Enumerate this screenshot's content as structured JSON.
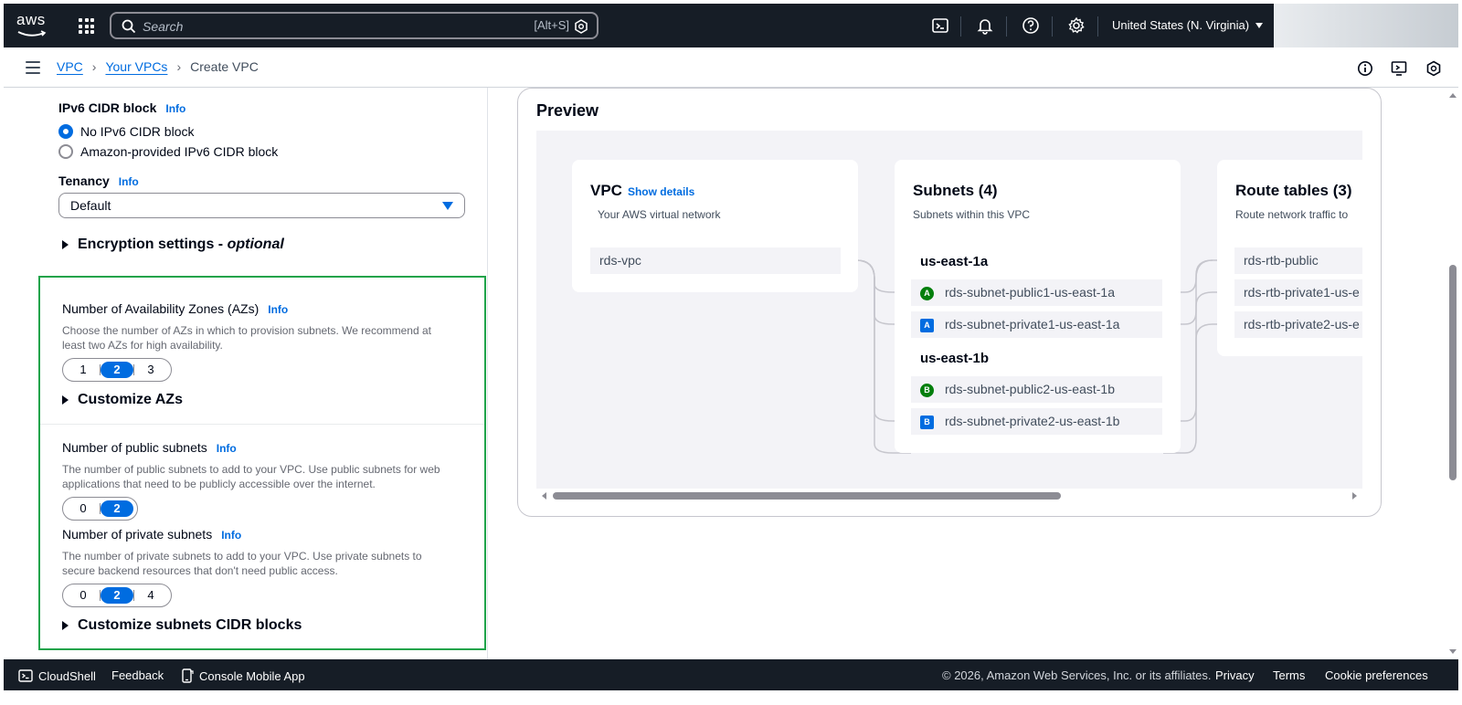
{
  "topnav": {
    "logo_text": "aws",
    "search_placeholder": "Search",
    "search_shortcut": "[Alt+S]",
    "region": "United States (N. Virginia)",
    "icons": [
      "cloudshell-icon",
      "bell-icon",
      "help-icon",
      "gear-icon"
    ]
  },
  "breadcrumb": {
    "items": [
      "VPC",
      "Your VPCs"
    ],
    "current": "Create VPC"
  },
  "form": {
    "ipv6": {
      "label": "IPv6 CIDR block",
      "info": "Info",
      "options": [
        "No IPv6 CIDR block",
        "Amazon-provided IPv6 CIDR block"
      ],
      "selected": "No IPv6 CIDR block"
    },
    "tenancy": {
      "label": "Tenancy",
      "info": "Info",
      "value": "Default"
    },
    "encryption": {
      "label": "Encryption settings - ",
      "optional": "optional"
    },
    "azs": {
      "label": "Number of Availability Zones (AZs)",
      "info": "Info",
      "description": "Choose the number of AZs in which to provision subnets. We recommend at least two AZs for high availability.",
      "options": [
        "1",
        "2",
        "3"
      ],
      "selected": "2",
      "customize": "Customize AZs"
    },
    "public_subnets": {
      "label": "Number of public subnets",
      "info": "Info",
      "description": "The number of public subnets to add to your VPC. Use public subnets for web applications that need to be publicly accessible over the internet.",
      "options": [
        "0",
        "2"
      ],
      "selected": "2"
    },
    "private_subnets": {
      "label": "Number of private subnets",
      "info": "Info",
      "description": "The number of private subnets to add to your VPC. Use private subnets to secure backend resources that don't need public access.",
      "options": [
        "0",
        "2",
        "4"
      ],
      "selected": "2",
      "customize": "Customize subnets CIDR blocks"
    }
  },
  "preview": {
    "title": "Preview",
    "vpc": {
      "title": "VPC",
      "show_details": "Show details",
      "subtitle": "Your AWS virtual network",
      "name": "rds-vpc"
    },
    "subnets": {
      "title": "Subnets (4)",
      "subtitle": "Subnets within this VPC",
      "az1": "us-east-1a",
      "az2": "us-east-1b",
      "items": [
        {
          "badge": "A",
          "name": "rds-subnet-public1-us-east-1a"
        },
        {
          "badge": "A",
          "name": "rds-subnet-private1-us-east-1a"
        },
        {
          "badge": "B",
          "name": "rds-subnet-public2-us-east-1b"
        },
        {
          "badge": "B",
          "name": "rds-subnet-private2-us-east-1b"
        }
      ]
    },
    "route_tables": {
      "title": "Route tables (3)",
      "subtitle": "Route network traffic to",
      "items": [
        "rds-rtb-public",
        "rds-rtb-private1-us-e",
        "rds-rtb-private2-us-e"
      ]
    }
  },
  "footer": {
    "cloudshell": "CloudShell",
    "feedback": "Feedback",
    "mobile_app": "Console Mobile App",
    "copyright": "© 2026, Amazon Web Services, Inc. or its affiliates.",
    "privacy": "Privacy",
    "terms": "Terms",
    "cookies": "Cookie preferences"
  },
  "colors": {
    "nav_bg": "#161d26",
    "link": "#006ce0",
    "public_badge": "#037f0c",
    "private_badge": "#006ce0",
    "highlight_border": "#1fa34a"
  }
}
